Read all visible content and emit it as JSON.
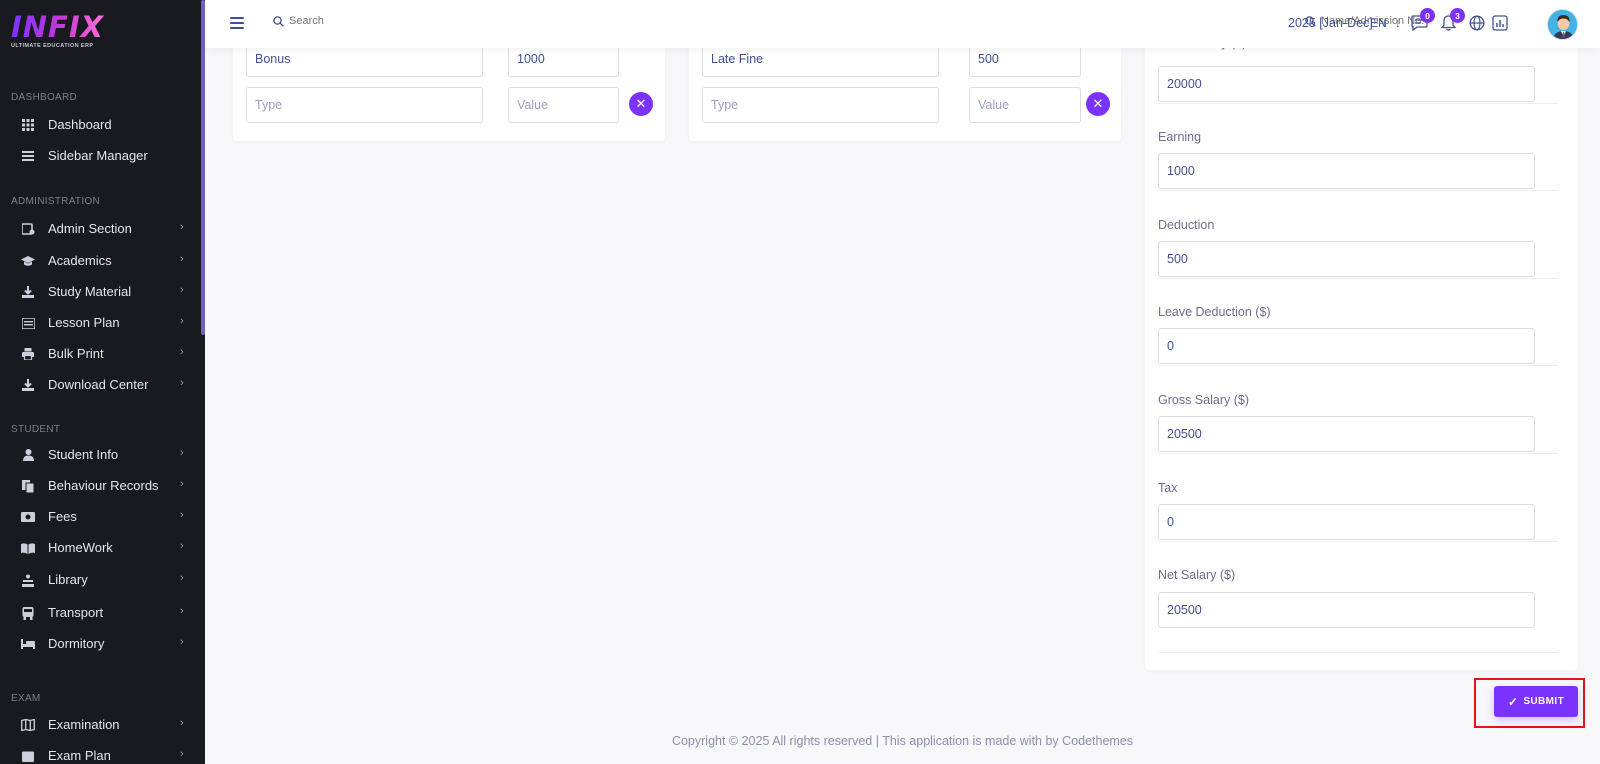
{
  "brand": {
    "name": "INFIX",
    "tagline": "ULTIMATE EDUCATION ERP"
  },
  "sidebar": {
    "sections": [
      {
        "title": "DASHBOARD",
        "items": [
          {
            "label": "Dashboard",
            "icon": "grid-icon",
            "chevron": false
          },
          {
            "label": "Sidebar Manager",
            "icon": "menu-icon",
            "chevron": false
          }
        ]
      },
      {
        "title": "ADMINISTRATION",
        "items": [
          {
            "label": "Admin Section",
            "icon": "admin-icon",
            "chevron": true
          },
          {
            "label": "Academics",
            "icon": "graduation-cap-icon",
            "chevron": true
          },
          {
            "label": "Study Material",
            "icon": "download-icon",
            "chevron": true
          },
          {
            "label": "Lesson Plan",
            "icon": "list-icon",
            "chevron": true
          },
          {
            "label": "Bulk Print",
            "icon": "printer-icon",
            "chevron": true
          },
          {
            "label": "Download Center",
            "icon": "download-icon",
            "chevron": true
          }
        ]
      },
      {
        "title": "STUDENT",
        "items": [
          {
            "label": "Student Info",
            "icon": "user-icon",
            "chevron": true
          },
          {
            "label": "Behaviour Records",
            "icon": "files-icon",
            "chevron": true
          },
          {
            "label": "Fees",
            "icon": "money-icon",
            "chevron": true
          },
          {
            "label": "HomeWork",
            "icon": "book-icon",
            "chevron": true
          },
          {
            "label": "Library",
            "icon": "library-icon",
            "chevron": true
          },
          {
            "label": "Transport",
            "icon": "bus-icon",
            "chevron": true
          },
          {
            "label": "Dormitory",
            "icon": "bed-icon",
            "chevron": true
          }
        ]
      },
      {
        "title": "EXAM",
        "items": [
          {
            "label": "Examination",
            "icon": "map-icon",
            "chevron": true
          },
          {
            "label": "Exam Plan",
            "icon": "calendar-icon",
            "chevron": true
          }
        ]
      }
    ]
  },
  "header": {
    "search_placeholder": "Search",
    "student_search_placeholder": "Name/Admission No.",
    "session": "2025 [Jan-Dec]",
    "language": "EN",
    "messages_count": "0",
    "notifications_count": "3"
  },
  "earnings": {
    "rows": [
      {
        "type": "Bonus",
        "value": "1000"
      },
      {
        "type": "",
        "value": ""
      }
    ],
    "type_placeholder": "Type",
    "value_placeholder": "Value"
  },
  "deductions": {
    "rows": [
      {
        "type": "Late Fine",
        "value": "500"
      },
      {
        "type": "",
        "value": ""
      }
    ],
    "type_placeholder": "Type",
    "value_placeholder": "Value"
  },
  "summary": {
    "partial_label": "Basic Salary ($)",
    "basic_salary": "20000",
    "fields": [
      {
        "label": "Earning",
        "value": "1000"
      },
      {
        "label": "Deduction",
        "value": "500"
      },
      {
        "label": "Leave Deduction ($)",
        "value": "0"
      },
      {
        "label": "Gross Salary ($)",
        "value": "20500"
      },
      {
        "label": "Tax",
        "value": "0"
      },
      {
        "label": "Net Salary ($)",
        "value": "20500"
      }
    ]
  },
  "submit_label": "SUBMIT",
  "footer": "Copyright © 2025 All rights reserved | This application is made with by Codethemes",
  "colors": {
    "accent": "#7c32ff",
    "sidebar_bg": "#191920",
    "text": "#415094",
    "highlight": "#e5141a"
  }
}
